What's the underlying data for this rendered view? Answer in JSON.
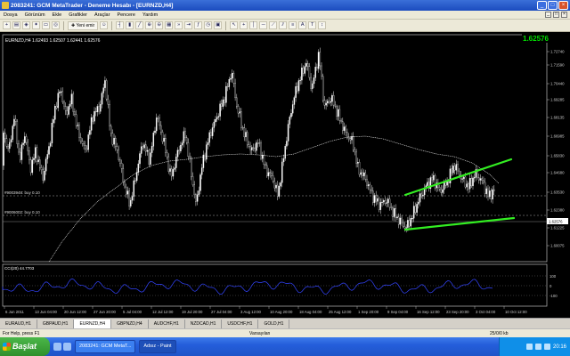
{
  "window": {
    "title": "2083241: GCM MetaTrader - Deneme Hesabı - [EURNZD,H4]",
    "buttons": [
      "_",
      "□",
      "×"
    ]
  },
  "menu": [
    "Dosya",
    "Görünüm",
    "Ekle",
    "Grafikler",
    "Araçlar",
    "Pencere",
    "Yardım"
  ],
  "mdi_buttons": [
    "_",
    "□",
    "×"
  ],
  "toolbar": {
    "new_order_label": "Yeni emir",
    "icons": [
      "new-chart-icon",
      "profiles-icon",
      "market-watch-icon",
      "navigator-icon",
      "terminal-icon",
      "strategy-tester-icon",
      "new-order-icon",
      "expert-advisors-icon",
      "bar-chart-icon",
      "candle-chart-icon",
      "line-chart-icon",
      "zoom-in-icon",
      "zoom-out-icon",
      "tile-icon",
      "autoscroll-icon",
      "chart-shift-icon",
      "indicators-icon",
      "periods-icon",
      "templates-icon",
      "cursor-icon",
      "crosshair-icon",
      "vertical-line-icon",
      "horizontal-line-icon",
      "trendline-icon",
      "channel-icon",
      "fibonacci-icon",
      "text-icon",
      "label-icon",
      "arrows-icon"
    ]
  },
  "chart": {
    "symbol_header": "EURNZD,H4  1.62493 1.62507 1.62441 1.62576",
    "current_price": "1.62576",
    "price_ticks": [
      "1.72740",
      "1.71590",
      "1.70440",
      "1.69285",
      "1.68135",
      "1.66985",
      "1.65830",
      "1.64680",
      "1.63530",
      "1.62576",
      "1.62380",
      "1.61225",
      "1.60075"
    ],
    "hline_labels": [
      "#9003948: buy 0.10",
      "#9006002: buy 0.10"
    ],
    "time_ticks": [
      "6 Jun 2011",
      "13 Jun 04:00",
      "20 Jun 12:00",
      "27 Jun 20:00",
      "5 Jul 04:00",
      "12 Jul 12:00",
      "19 Jul 20:00",
      "27 Jul 04:00",
      "3 Aug 12:00",
      "10 Aug 20:00",
      "18 Aug 04:00",
      "25 Aug 12:00",
      "1 Sep 20:00",
      "9 Sep 04:00",
      "16 Sep 12:00",
      "23 Sep 20:00",
      "3 Oct 04:00",
      "10 Oct 12:00"
    ],
    "indicator_label": "CCI(20) 44.7703",
    "indicator_ticks": [
      "100",
      "0",
      "-100"
    ]
  },
  "tabs": [
    "EURAUD,H1",
    "GBPAUD,H1",
    "EURNZD,H4",
    "GBPNZD,H4",
    "AUDCHF,H1",
    "NZDCAD,H1",
    "USDCHF,H1",
    "GOLD,H1"
  ],
  "active_tab": "EURNZD,H4",
  "status": {
    "help": "For Help, press F1",
    "profile": "Varsayılan",
    "traffic": "25/0/0 kb"
  },
  "taskbar": {
    "start_label": "Başlat",
    "tasks": [
      "2083241: GCM MetaT...",
      "Adsız - Paint"
    ],
    "clock": "20:16"
  },
  "colors": {
    "channel_line": "#33ee22",
    "candle": "#ffffff",
    "moving_average": "#ffffff",
    "cci_line": "#3344ff",
    "current_price_badge": "#00dd00"
  }
}
